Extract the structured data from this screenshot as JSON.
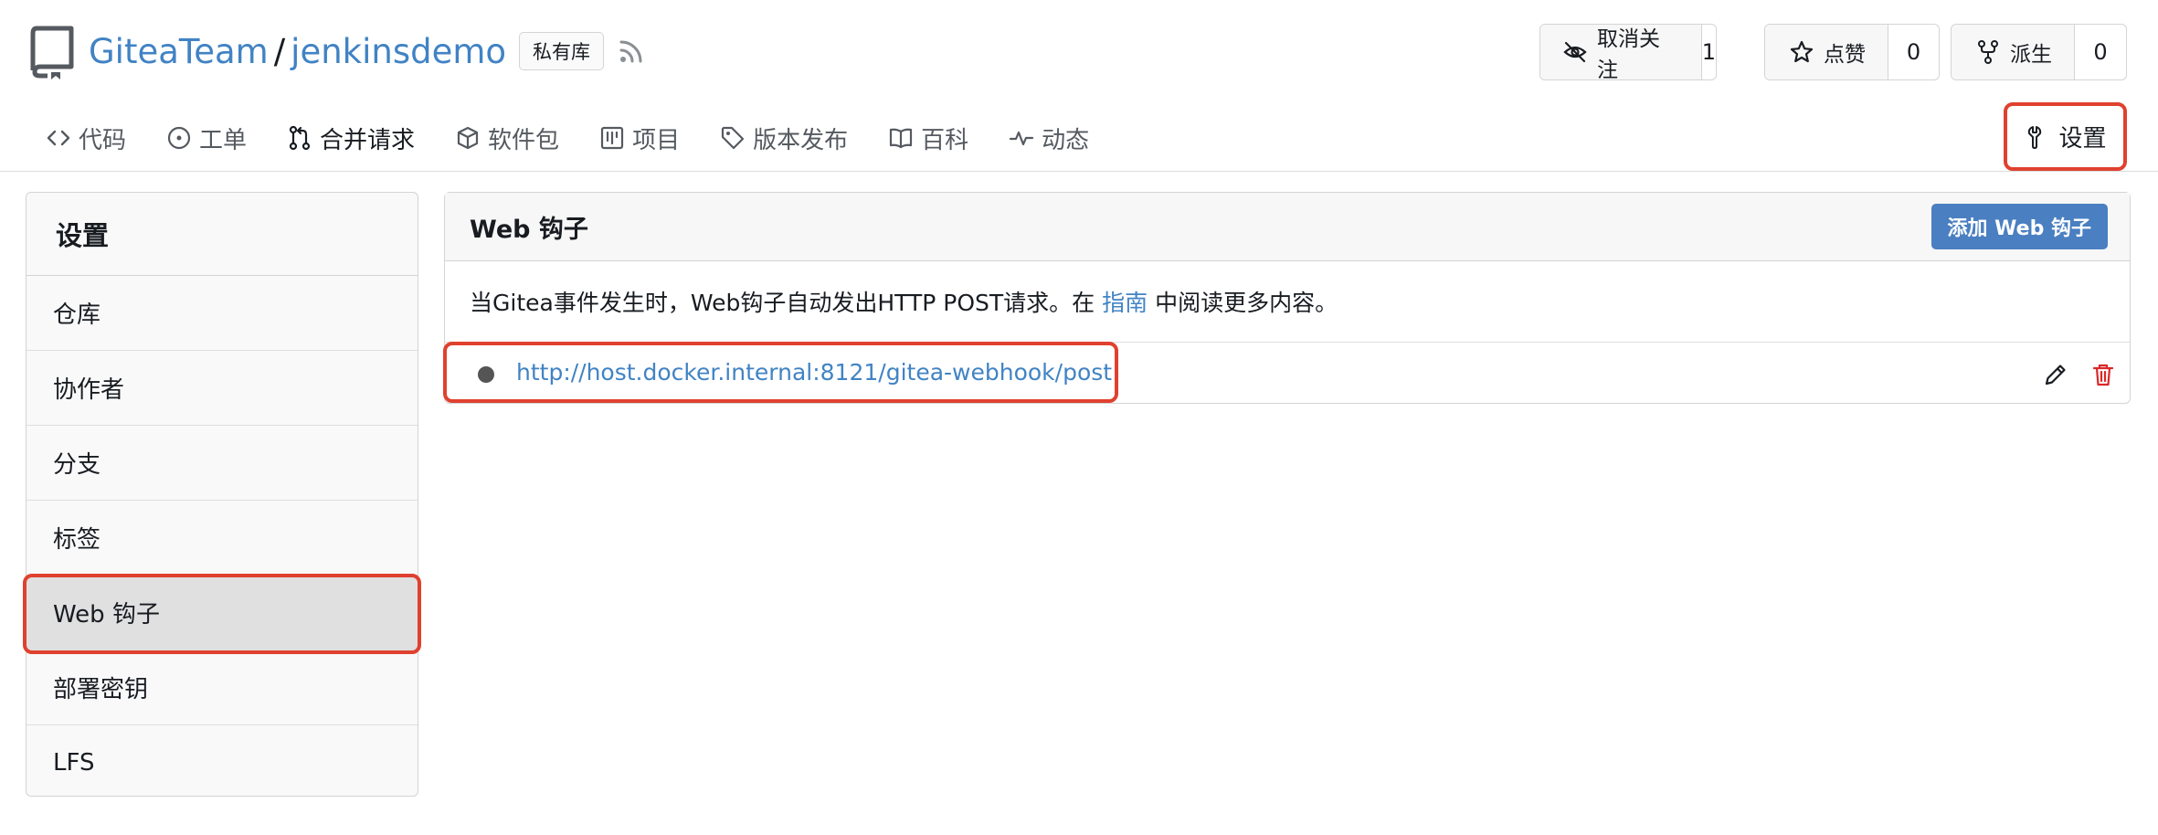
{
  "repo": {
    "owner": "GiteaTeam",
    "separator": "/",
    "name": "jenkinsdemo",
    "private_label": "私有库"
  },
  "actions": {
    "watch": {
      "label": "取消关注",
      "count": "1"
    },
    "star": {
      "label": "点赞",
      "count": "0"
    },
    "fork": {
      "label": "派生",
      "count": "0"
    }
  },
  "tabs": [
    {
      "label": "代码",
      "icon": "code-icon"
    },
    {
      "label": "工单",
      "icon": "issue-icon"
    },
    {
      "label": "合并请求",
      "icon": "pull-request-icon"
    },
    {
      "label": "软件包",
      "icon": "package-icon"
    },
    {
      "label": "项目",
      "icon": "project-icon"
    },
    {
      "label": "版本发布",
      "icon": "tag-icon"
    },
    {
      "label": "百科",
      "icon": "book-icon"
    },
    {
      "label": "动态",
      "icon": "pulse-icon"
    }
  ],
  "settings_tab": {
    "label": "设置",
    "icon": "tools-icon"
  },
  "sidebar": {
    "title": "设置",
    "items": [
      {
        "label": "仓库"
      },
      {
        "label": "协作者"
      },
      {
        "label": "分支"
      },
      {
        "label": "标签"
      },
      {
        "label": "Web 钩子"
      },
      {
        "label": "部署密钥"
      },
      {
        "label": "LFS"
      }
    ]
  },
  "webhooks": {
    "title": "Web 钩子",
    "add_button": "添加 Web 钩子",
    "desc_before": "当Gitea事件发生时，Web钩子自动发出HTTP POST请求。在",
    "desc_link": "指南",
    "desc_after": "中阅读更多内容。",
    "hooks": [
      {
        "url": "http://host.docker.internal:8121/gitea-webhook/post"
      }
    ]
  },
  "colors": {
    "link": "#4183c4",
    "highlight": "#e0412f",
    "button": "#4a7fc1"
  }
}
